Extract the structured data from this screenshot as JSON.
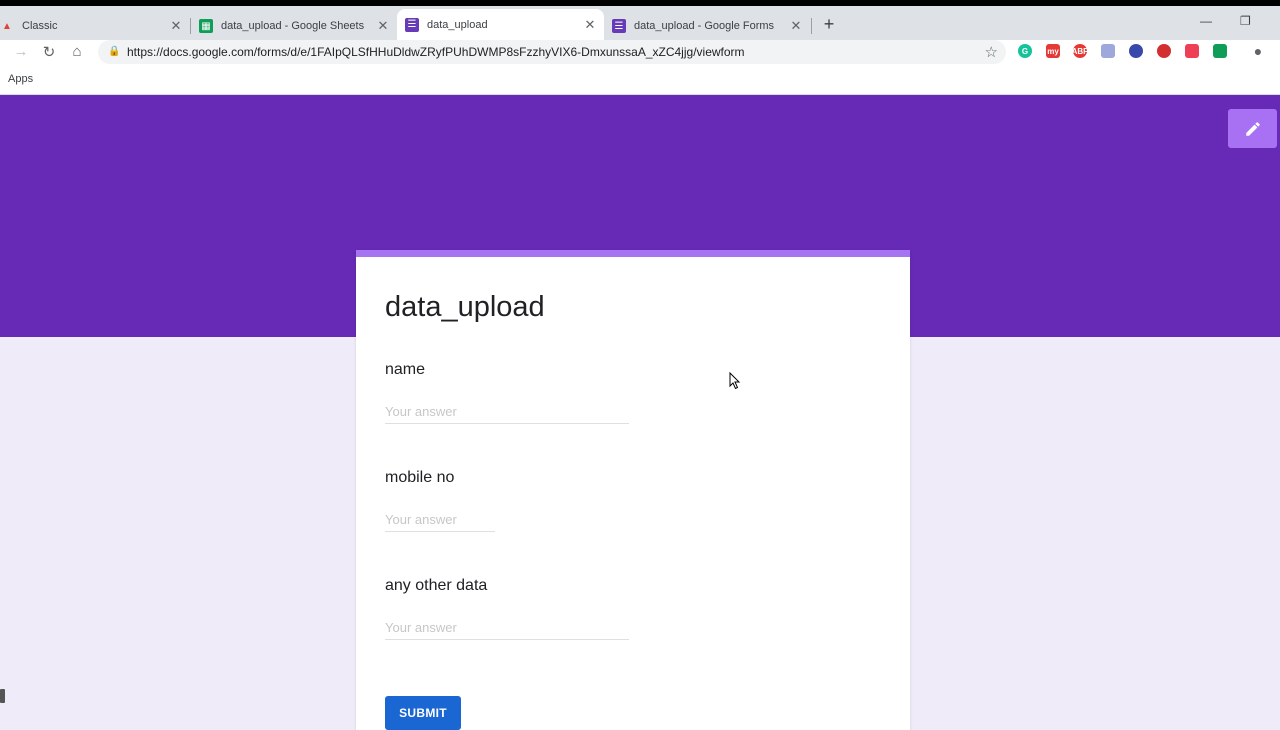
{
  "tabs": [
    {
      "title": "Classic",
      "favicon": "classic-icon",
      "color": "#db4437"
    },
    {
      "title": "data_upload - Google Sheets",
      "favicon": "sheets-icon",
      "color": "#0f9d58"
    },
    {
      "title": "data_upload",
      "favicon": "forms-icon",
      "color": "#673ab7",
      "active": true
    },
    {
      "title": "data_upload - Google Forms",
      "favicon": "forms-icon",
      "color": "#673ab7"
    }
  ],
  "url": "https://docs.google.com/forms/d/e/1FAIpQLSfHHuDldwZRyfPUhDWMP8sFzzhyVIX6-DmxunssaA_xZC4jjg/viewform",
  "bookmarks": {
    "apps_label": "Apps"
  },
  "extensions": [
    {
      "name": "grammarly-icon",
      "color": "#15c39a",
      "glyph": "G"
    },
    {
      "name": "my-extension-icon",
      "color": "#e53935",
      "glyph": "my"
    },
    {
      "name": "adblock-icon",
      "color": "#e53935",
      "glyph": "ABP"
    },
    {
      "name": "screenshot-icon",
      "color": "#9fa8da",
      "glyph": ""
    },
    {
      "name": "search-extension-icon",
      "color": "#3949ab",
      "glyph": ""
    },
    {
      "name": "lastpass-icon",
      "color": "#d32f2f",
      "glyph": ""
    },
    {
      "name": "pocket-icon",
      "color": "#ef3f56",
      "glyph": ""
    },
    {
      "name": "sheets-extension-icon",
      "color": "#0f9d58",
      "glyph": ""
    }
  ],
  "colors": {
    "banner": "#672ab6",
    "card_accent": "#a674f0",
    "page_bg": "#f0ebf8",
    "submit": "#1a66d2"
  },
  "form": {
    "title": "data_upload",
    "questions": [
      {
        "label": "name",
        "placeholder": "Your answer"
      },
      {
        "label": "mobile no",
        "placeholder": "Your answer"
      },
      {
        "label": "any other data",
        "placeholder": "Your answer"
      }
    ],
    "submit_label": "SUBMIT"
  }
}
